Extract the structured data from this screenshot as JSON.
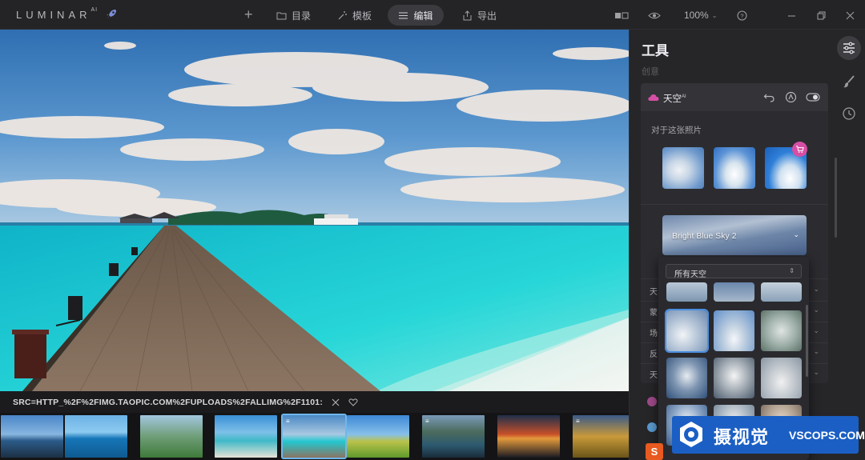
{
  "app": {
    "logo": "LUMINAR",
    "logo_sup": "AI"
  },
  "toolbar": {
    "catalog_label": "目录",
    "templates_label": "模板",
    "edit_label": "编辑",
    "export_label": "导出",
    "zoom_label": "100%"
  },
  "file": {
    "path": "SRC=HTTP_%2F%2FIMG.TAOPIC.COM%2FUPLOADS%2FALLIMG%2F1101:"
  },
  "panel": {
    "title": "工具",
    "subtitle": "创意",
    "tool_name": "天空",
    "tool_sup": "AI",
    "for_this_photo": "对于这张照片",
    "selected_sky": "Bright Blue Sky 2",
    "slider_rows": [
      {
        "label": "天"
      },
      {
        "label": "蒙"
      },
      {
        "label": "场"
      },
      {
        "label": "反"
      },
      {
        "label": "天"
      }
    ]
  },
  "dropdown": {
    "filter_label": "所有天空"
  },
  "watermark": {
    "brand": "摄视觉",
    "site": "VSCOPS.COM",
    "ime": "S"
  },
  "colors": {
    "accent": "#6fb7ea",
    "tool_pink": "#d64fa4",
    "watermark_blue": "#1b5fc4"
  }
}
